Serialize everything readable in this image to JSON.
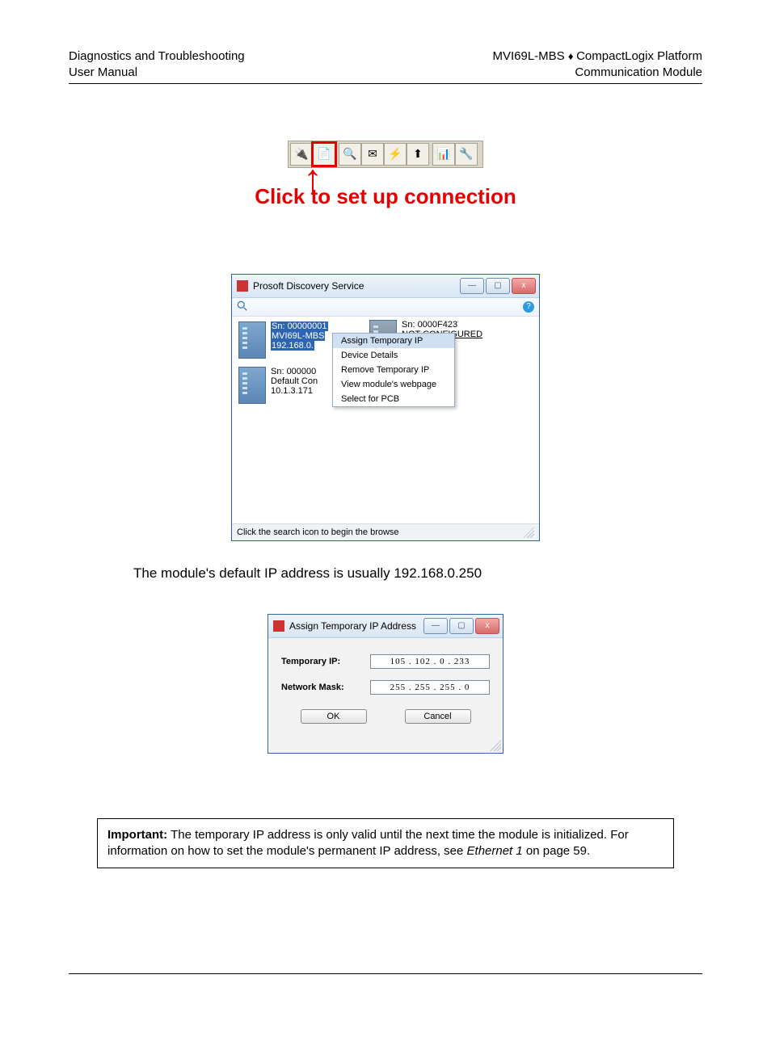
{
  "header": {
    "left_line1": "Diagnostics and Troubleshooting",
    "left_line2": "User Manual",
    "right_line1_a": "MVI69L-MBS",
    "right_line1_b": "CompactLogix Platform",
    "right_line2": "Communication Module"
  },
  "toolbar_caption": "Click to set up connection",
  "ps_window": {
    "title": "Prosoft Discovery Service",
    "device1_sn": "Sn: 00000001",
    "device1_model": "MVI69L-MBS",
    "device1_ip": "192.168.0.",
    "device2_sn": "Sn: 000000",
    "device2_desc": "Default Con",
    "device2_ip": "10.1.3.171",
    "device3_sn": "Sn: 0000F423",
    "device3_status": "NOT CONFIGURED",
    "menu": {
      "assign": "Assign Temporary IP",
      "details": "Device Details",
      "remove": "Remove Temporary IP",
      "webpage": "View module's webpage",
      "pcb": "Select for PCB"
    },
    "status": "Click the search icon to begin the browse"
  },
  "body_text": "The module's default IP address is usually 192.168.0.250",
  "ip_window": {
    "title": "Assign Temporary IP Address",
    "label_ip": "Temporary IP:",
    "value_ip": "105 . 102 .   0   . 233",
    "label_mask": "Network Mask:",
    "value_mask": "255 . 255 . 255 .   0",
    "ok": "OK",
    "cancel": "Cancel"
  },
  "important": {
    "label": "Important:",
    "text1": " The temporary IP address is only valid until the next time the module is initialized. For information on how to set the module's permanent IP address, see ",
    "ref": "Ethernet 1",
    "text2": " on page 59."
  }
}
